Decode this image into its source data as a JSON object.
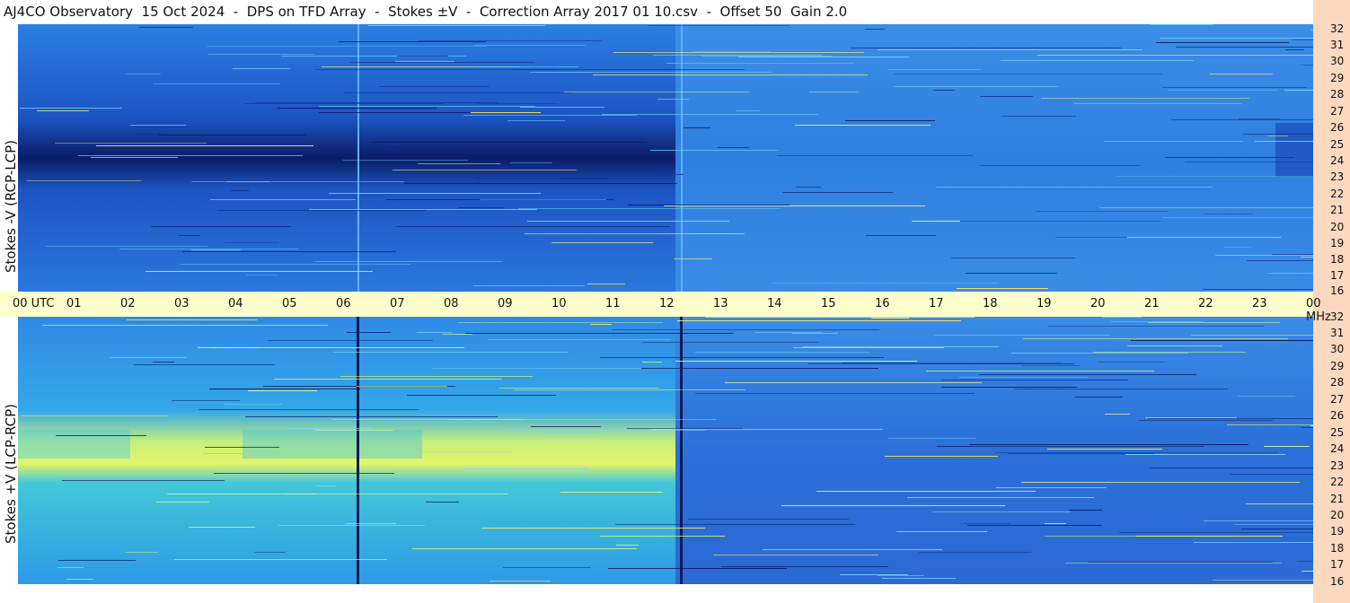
{
  "title": "AJ4CO Observatory  15 Oct 2024  -  DPS on TFD Array  -  Stokes ±V  -  Correction Array 2017 01 10.csv  -  Offset 50  Gain 2.0",
  "panels": {
    "top_label": "Stokes -V (RCP-LCP)",
    "bottom_label": "Stokes +V (LCP-RCP)"
  },
  "time_axis": {
    "labels": [
      "00 UTC",
      "01",
      "02",
      "03",
      "04",
      "05",
      "06",
      "07",
      "08",
      "09",
      "10",
      "11",
      "12",
      "13",
      "14",
      "15",
      "16",
      "17",
      "18",
      "19",
      "20",
      "21",
      "22",
      "23",
      "00 MHz"
    ]
  },
  "freq_axis": {
    "labels": [
      "32",
      "31",
      "30",
      "29",
      "28",
      "27",
      "26",
      "25",
      "24",
      "23",
      "22",
      "21",
      "20",
      "19",
      "18",
      "17",
      "16"
    ]
  },
  "colors": {
    "title_bg": "#ffffff",
    "axis_bg": "#ffffcc",
    "right_strip": "#fcd8bf",
    "spectrogram_base": "#2a7de0"
  }
}
